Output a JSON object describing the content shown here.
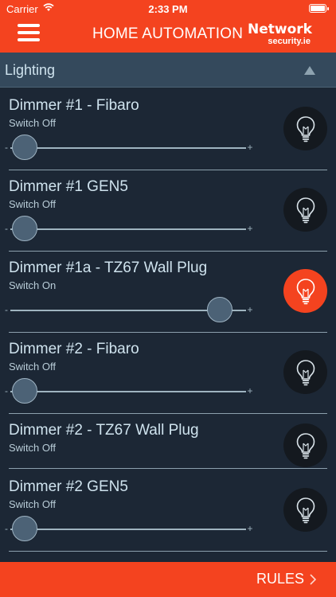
{
  "status_bar": {
    "carrier": "Carrier",
    "time": "2:33 PM",
    "battery": 1.0
  },
  "header": {
    "title": "HOME AUTOMATION",
    "brand_name": "Network",
    "brand_domain": "security.ie",
    "menu_icon": "hamburger-menu-icon",
    "accent_color": "#f4431f"
  },
  "section": {
    "label": "Lighting",
    "collapse_icon": "triangle-up-icon"
  },
  "devices": [
    {
      "name": "Dimmer #1 - Fibaro",
      "state": "Switch Off",
      "on": false,
      "has_slider": true,
      "level": 0.0
    },
    {
      "name": "Dimmer #1 GEN5",
      "state": "Switch Off",
      "on": false,
      "has_slider": true,
      "level": 0.0
    },
    {
      "name": "Dimmer #1a - TZ67 Wall Plug",
      "state": "Switch On",
      "on": true,
      "has_slider": true,
      "level": 0.95
    },
    {
      "name": "Dimmer #2 - Fibaro",
      "state": "Switch Off",
      "on": false,
      "has_slider": true,
      "level": 0.0
    },
    {
      "name": "Dimmer #2 - TZ67 Wall Plug",
      "state": "Switch Off",
      "on": false,
      "has_slider": false,
      "level": null
    },
    {
      "name": "Dimmer #2 GEN5",
      "state": "Switch Off",
      "on": false,
      "has_slider": true,
      "level": 0.0
    }
  ],
  "slider_labels": {
    "minus": "-",
    "plus": "+"
  },
  "footer": {
    "rules_label": "RULES",
    "rules_icon": "chevron-right-icon"
  }
}
